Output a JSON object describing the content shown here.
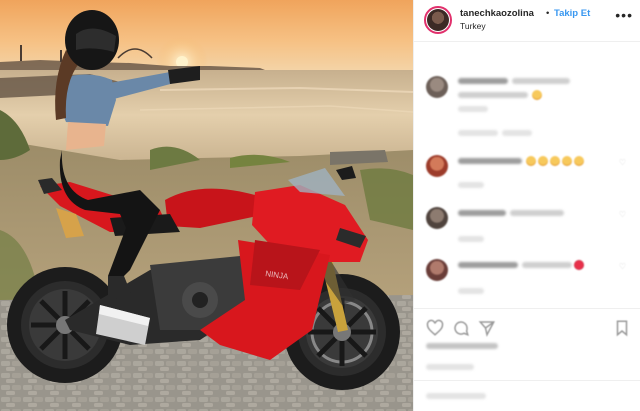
{
  "post": {
    "username": "tanechkaozolina",
    "separator": "•",
    "follow_label": "Takip Et",
    "location": "Turkey"
  },
  "icons": {
    "more": "more-horizontal-icon",
    "like": "heart-icon",
    "comment": "comment-icon",
    "share": "share-icon",
    "save": "bookmark-icon"
  },
  "colors": {
    "follow": "#3897f0",
    "story_ring": "#e1306c",
    "motorcycle": "#d8171d",
    "sky_top": "#f2a35a",
    "sea": "#d9c3a3"
  }
}
